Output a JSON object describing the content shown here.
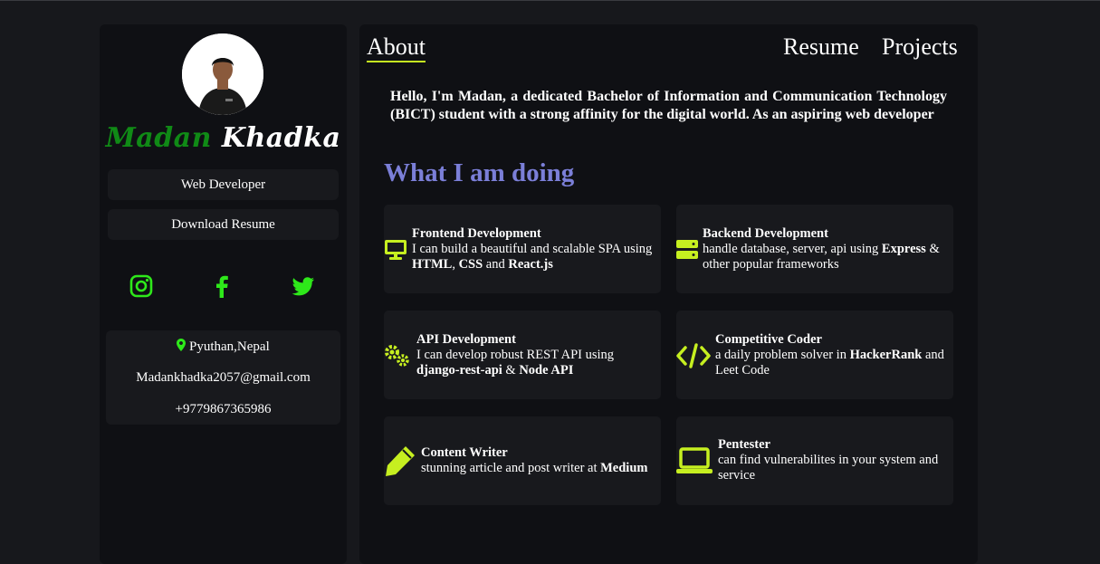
{
  "sidebar": {
    "first_name": "Madan",
    "last_name": "Khadka",
    "role": "Web Developer",
    "download_label": "Download Resume",
    "socials": [
      "instagram-icon",
      "facebook-icon",
      "twitter-icon"
    ],
    "location": "Pyuthan,Nepal",
    "email": "Madankhadka2057@gmail.com",
    "phone": "+9779867365986"
  },
  "nav": {
    "about": "About",
    "resume": "Resume",
    "projects": "Projects"
  },
  "intro": "Hello, I'm Madan, a dedicated Bachelor of Information and Communication Technology (BICT) student with a strong affinity for the digital world. As an aspiring web developer",
  "section_title": "What I am doing",
  "services": [
    {
      "title": "Frontend Development",
      "pre": "I can build a beautiful and scalable SPA using ",
      "b1": "HTML",
      "mid1": ", ",
      "b2": "CSS",
      "mid2": " and ",
      "b3": "React.js",
      "post": "",
      "icon": "monitor-icon"
    },
    {
      "title": "Backend Development",
      "pre": "handle database, server, api using ",
      "b1": "Express",
      "mid1": " & other popular frameworks",
      "icon": "server-icon"
    },
    {
      "title": "API Development",
      "pre": "I can develop robust REST API using ",
      "b1": "django-rest-api",
      "mid1": " & ",
      "b2": "Node API",
      "icon": "gears-icon"
    },
    {
      "title": "Competitive Coder",
      "pre": "a daily problem solver in ",
      "b1": "HackerRank",
      "mid1": " and Leet Code",
      "icon": "code-icon"
    },
    {
      "title": "Content Writer",
      "pre": "stunning article and post writer at ",
      "b1": "Medium",
      "icon": "pen-icon"
    },
    {
      "title": "Pentester",
      "pre": "can find vulnerabilites in your system and service",
      "icon": "laptop-icon"
    }
  ],
  "colors": {
    "accent": "#c6ef20",
    "name_green": "#108a16",
    "title_purple": "#7b7fd8",
    "social_green": "#2ee81a"
  }
}
